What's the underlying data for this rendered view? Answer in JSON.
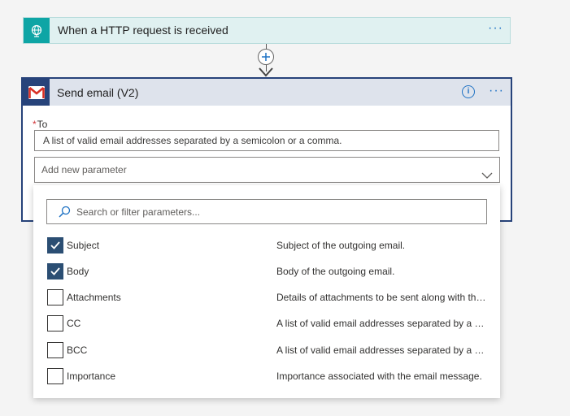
{
  "trigger": {
    "title": "When a HTTP request is received",
    "icon": "globe-request-icon",
    "more": "···"
  },
  "action": {
    "title": "Send email (V2)",
    "icon": "gmail-icon",
    "more": "···",
    "info": "i",
    "to": {
      "required_mark": "*",
      "label": "To",
      "placeholder": "A list of valid email addresses separated by a semicolon or a comma."
    },
    "add_param": {
      "placeholder": "Add new parameter"
    }
  },
  "panel": {
    "search_placeholder": "Search or filter parameters...",
    "items": [
      {
        "name": "Subject",
        "desc": "Subject of the outgoing email.",
        "checked": true
      },
      {
        "name": "Body",
        "desc": "Body of the outgoing email.",
        "checked": true
      },
      {
        "name": "Attachments",
        "desc": "Details of attachments to be sent along with the email.",
        "checked": false
      },
      {
        "name": "CC",
        "desc": "A list of valid email addresses separated by a semicolon or a comma.",
        "checked": false
      },
      {
        "name": "BCC",
        "desc": "A list of valid email addresses separated by a semicolon or a comma.",
        "checked": false
      },
      {
        "name": "Importance",
        "desc": "Importance associated with the email message.",
        "checked": false
      }
    ]
  },
  "colors": {
    "trigger_accent": "#0ea5a5",
    "action_border": "#27437a",
    "link_blue": "#1f72c4",
    "checkbox_checked": "#2b4e73"
  }
}
